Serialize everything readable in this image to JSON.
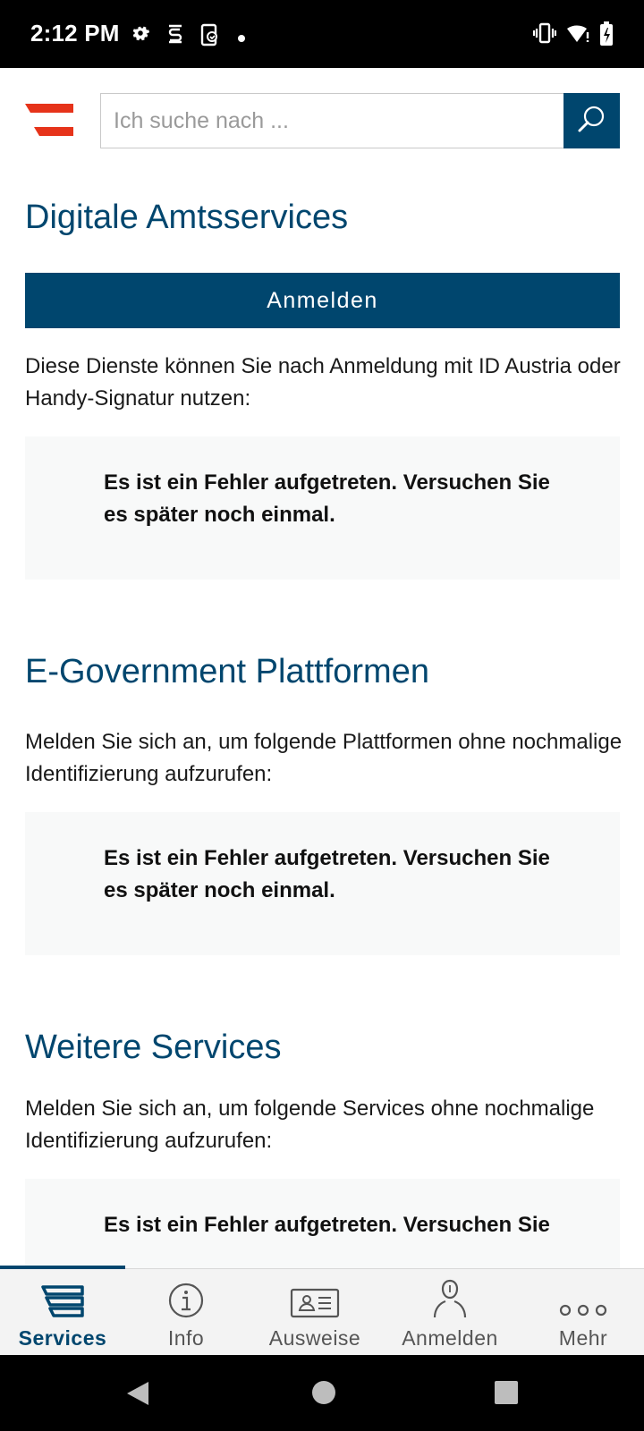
{
  "status_bar": {
    "time": "2:12 PM",
    "left_icons": [
      "settings-icon",
      "s-app-icon",
      "screenshot-icon",
      "notification-dot-icon"
    ],
    "right_icons": [
      "vibrate-icon",
      "wifi-icon",
      "battery-charging-icon"
    ]
  },
  "header": {
    "logo": "austria-flag-logo",
    "search": {
      "placeholder": "Ich suche nach ...",
      "value": ""
    },
    "search_button_icon": "search-icon"
  },
  "colors": {
    "brand_blue": "#00466e",
    "flag_red": "#e6331a",
    "error_box_bg": "#f8f9f9"
  },
  "sections": {
    "digital": {
      "title": "Digitale Amtsservices",
      "button_label": "Anmelden",
      "description": "Diese Dienste können Sie nach Anmeldung mit ID Austria oder Handy-Signatur nutzen:",
      "error": "Es ist ein Fehler aufgetreten. Versuchen Sie es später noch einmal."
    },
    "egov": {
      "title": "E-Government Plattformen",
      "description": "Melden Sie sich an, um folgende Plattformen ohne nochmalige Identifizierung aufzurufen:",
      "error": "Es ist ein Fehler aufgetreten. Versuchen Sie es später noch einmal."
    },
    "more": {
      "title": "Weitere Services",
      "description": "Melden Sie sich an, um folgende Services ohne nochmalige Identifizierung aufzurufen:",
      "error": "Es ist ein Fehler aufgetreten. Versuchen Sie"
    }
  },
  "bottom_nav": {
    "items": [
      {
        "label": "Services",
        "icon": "services-icon",
        "active": true
      },
      {
        "label": "Info",
        "icon": "info-icon",
        "active": false
      },
      {
        "label": "Ausweise",
        "icon": "id-card-icon",
        "active": false
      },
      {
        "label": "Anmelden",
        "icon": "user-icon",
        "active": false
      },
      {
        "label": "Mehr",
        "icon": "more-dots-icon",
        "active": false
      }
    ]
  },
  "system_nav": [
    "back-icon",
    "home-icon",
    "recents-icon"
  ]
}
